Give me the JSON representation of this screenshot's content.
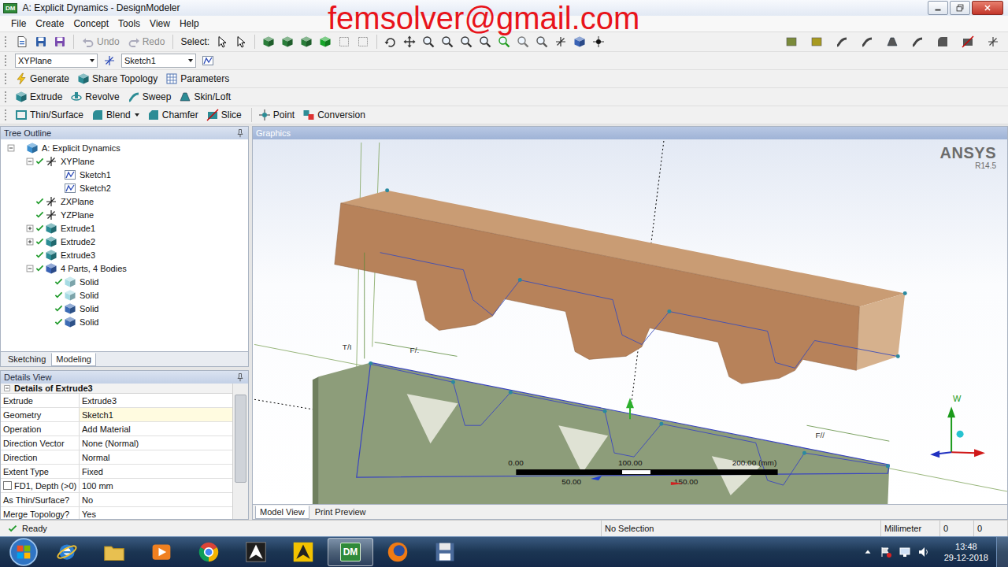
{
  "window": {
    "title": "A: Explicit Dynamics - DesignModeler",
    "app_icon": "DM"
  },
  "watermark": "femsolver@gmail.com",
  "menu": [
    "File",
    "Create",
    "Concept",
    "Tools",
    "View",
    "Help"
  ],
  "toolbar": {
    "undo": {
      "label": "Undo",
      "disabled": true
    },
    "redo": {
      "label": "Redo",
      "disabled": true
    },
    "select_label": "Select:"
  },
  "plane_select": "XYPlane",
  "sketch_select": "Sketch1",
  "feature_toolbar": [
    [
      [
        {
          "label": "Generate",
          "dropdown": false
        },
        {
          "label": "Share Topology",
          "dropdown": false
        },
        {
          "label": "Parameters",
          "dropdown": false
        }
      ]
    ],
    [
      [
        {
          "label": "Extrude",
          "dropdown": false
        },
        {
          "label": "Revolve",
          "dropdown": false
        },
        {
          "label": "Sweep",
          "dropdown": false
        },
        {
          "label": "Skin/Loft",
          "dropdown": false
        }
      ]
    ],
    [
      [
        {
          "label": "Thin/Surface",
          "dropdown": false
        },
        {
          "label": "Blend",
          "dropdown": true
        },
        {
          "label": "Chamfer",
          "dropdown": false
        },
        {
          "label": "Slice",
          "dropdown": false
        }
      ],
      [
        {
          "label": "Point",
          "dropdown": false
        },
        {
          "label": "Conversion",
          "dropdown": false
        }
      ]
    ]
  ],
  "tree": {
    "title": "Tree Outline",
    "items": [
      {
        "label": "A: Explicit Dynamics",
        "level": 0,
        "kind": "root",
        "expandable": true,
        "expanded": true,
        "checked": false
      },
      {
        "label": "XYPlane",
        "level": 1,
        "kind": "plane",
        "expandable": true,
        "expanded": true,
        "checked": true
      },
      {
        "label": "Sketch1",
        "level": 2,
        "kind": "sketch",
        "expandable": false,
        "expanded": false,
        "checked": false
      },
      {
        "label": "Sketch2",
        "level": 2,
        "kind": "sketch",
        "expandable": false,
        "expanded": false,
        "checked": false
      },
      {
        "label": "ZXPlane",
        "level": 1,
        "kind": "plane",
        "expandable": false,
        "expanded": false,
        "checked": true
      },
      {
        "label": "YZPlane",
        "level": 1,
        "kind": "plane",
        "expandable": false,
        "expanded": false,
        "checked": true
      },
      {
        "label": "Extrude1",
        "level": 1,
        "kind": "extrude",
        "expandable": true,
        "expanded": false,
        "checked": true
      },
      {
        "label": "Extrude2",
        "level": 1,
        "kind": "extrude",
        "expandable": true,
        "expanded": false,
        "checked": true
      },
      {
        "label": "Extrude3",
        "level": 1,
        "kind": "extrude",
        "expandable": false,
        "expanded": false,
        "checked": true
      },
      {
        "label": "4 Parts, 4 Bodies",
        "level": 1,
        "kind": "parts",
        "expandable": true,
        "expanded": true,
        "checked": true
      },
      {
        "label": "Solid",
        "level": 2,
        "kind": "solid",
        "expandable": false,
        "expanded": false,
        "checked": true,
        "color": "#a6dbe3"
      },
      {
        "label": "Solid",
        "level": 2,
        "kind": "solid",
        "expandable": false,
        "expanded": false,
        "checked": true,
        "color": "#a6dbe3"
      },
      {
        "label": "Solid",
        "level": 2,
        "kind": "solid",
        "expandable": false,
        "expanded": false,
        "checked": true,
        "color": "#3d6cb5"
      },
      {
        "label": "Solid",
        "level": 2,
        "kind": "solid",
        "expandable": false,
        "expanded": false,
        "checked": true,
        "color": "#3d6cb5"
      }
    ]
  },
  "mode_tabs": [
    {
      "label": "Sketching",
      "selected": false
    },
    {
      "label": "Modeling",
      "selected": true
    }
  ],
  "details": {
    "title": "Details View",
    "header": "Details of Extrude3",
    "rows": [
      {
        "name": "Extrude",
        "value": "Extrude3",
        "kind": "plain",
        "checked": false,
        "highlighted": false
      },
      {
        "name": "Geometry",
        "value": "Sketch1",
        "kind": "plain",
        "checked": false,
        "highlighted": true
      },
      {
        "name": "Operation",
        "value": "Add Material",
        "kind": "plain",
        "checked": false,
        "highlighted": false
      },
      {
        "name": "Direction Vector",
        "value": "None (Normal)",
        "kind": "plain",
        "checked": false,
        "highlighted": false
      },
      {
        "name": "Direction",
        "value": "Normal",
        "kind": "plain",
        "checked": false,
        "highlighted": false
      },
      {
        "name": "Extent Type",
        "value": "Fixed",
        "kind": "plain",
        "checked": false,
        "highlighted": false
      },
      {
        "name": "FD1, Depth (>0)",
        "value": "100 mm",
        "kind": "parameter",
        "checked": false,
        "highlighted": false
      },
      {
        "name": "As Thin/Surface?",
        "value": "No",
        "kind": "plain",
        "checked": false,
        "highlighted": false
      },
      {
        "name": "Merge Topology?",
        "value": "Yes",
        "kind": "plain",
        "checked": false,
        "highlighted": false
      }
    ]
  },
  "graphics": {
    "title": "Graphics",
    "logo": "ANSYS",
    "version": "R14.5",
    "scale": {
      "labels_top": [
        "0.00",
        "100.00",
        "200.00 (mm)"
      ],
      "labels_bottom": [
        "50.00",
        "150.00"
      ]
    },
    "dimensions": [
      "T/I",
      "F/.",
      "F//"
    ],
    "triad_label": "W"
  },
  "view_tabs": [
    {
      "label": "Model View",
      "selected": true
    },
    {
      "label": "Print Preview",
      "selected": false
    }
  ],
  "status_bar": {
    "message": "Ready",
    "selection": "No Selection",
    "units": "Millimeter",
    "fields": [
      "0",
      "0"
    ]
  },
  "taskbar": {
    "apps": [
      {
        "kind": "ie",
        "active": false
      },
      {
        "kind": "folder",
        "active": false
      },
      {
        "kind": "media",
        "active": false
      },
      {
        "kind": "chrome",
        "active": false
      },
      {
        "kind": "ansys",
        "active": false
      },
      {
        "kind": "ansys2",
        "active": false
      },
      {
        "kind": "dm",
        "active": true,
        "label": "DM"
      },
      {
        "kind": "firefox",
        "active": false
      },
      {
        "kind": "floppy",
        "active": false
      }
    ],
    "time": "13:48",
    "date": "29-12-2018"
  }
}
